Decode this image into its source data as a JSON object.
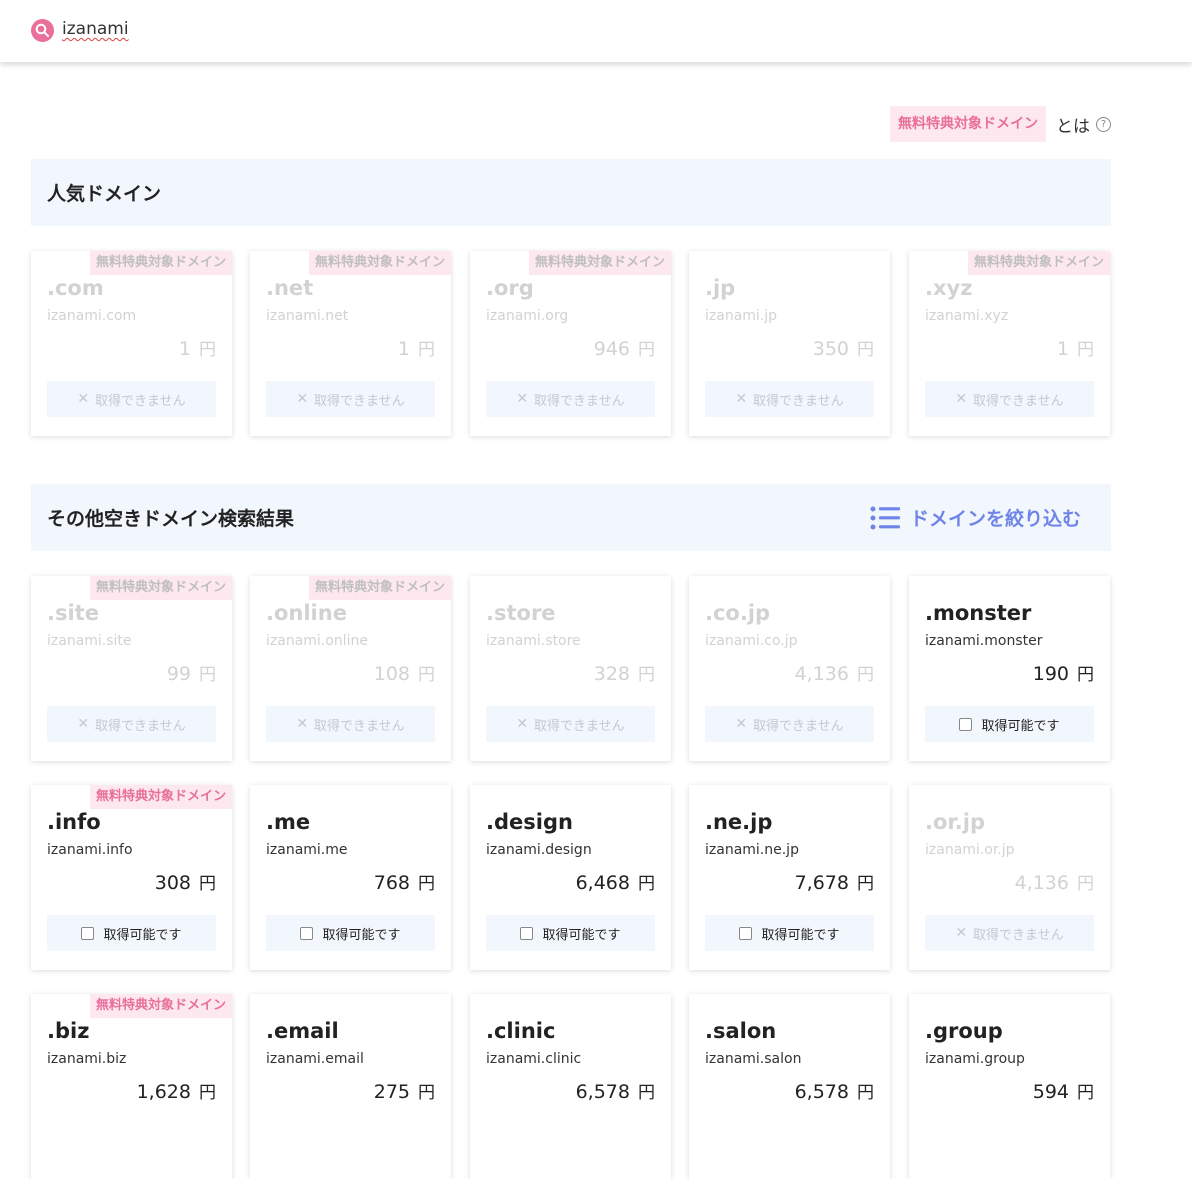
{
  "search": {
    "query": "izanami"
  },
  "info": {
    "badge": "無料特典対象ドメイン",
    "suffix": "とは",
    "help": "?"
  },
  "popular": {
    "title": "人気ドメイン",
    "cards": [
      {
        "tld": ".com",
        "fqdn": "izanami.com",
        "price": "1",
        "yen": "円",
        "free": true,
        "available": false,
        "badge": "無料特典対象ドメイン",
        "action": "取得できません"
      },
      {
        "tld": ".net",
        "fqdn": "izanami.net",
        "price": "1",
        "yen": "円",
        "free": true,
        "available": false,
        "badge": "無料特典対象ドメイン",
        "action": "取得できません"
      },
      {
        "tld": ".org",
        "fqdn": "izanami.org",
        "price": "946",
        "yen": "円",
        "free": true,
        "available": false,
        "badge": "無料特典対象ドメイン",
        "action": "取得できません"
      },
      {
        "tld": ".jp",
        "fqdn": "izanami.jp",
        "price": "350",
        "yen": "円",
        "free": false,
        "available": false,
        "badge": "",
        "action": "取得できません"
      },
      {
        "tld": ".xyz",
        "fqdn": "izanami.xyz",
        "price": "1",
        "yen": "円",
        "free": true,
        "available": false,
        "badge": "無料特典対象ドメイン",
        "action": "取得できません"
      }
    ]
  },
  "others": {
    "title": "その他空きドメイン検索結果",
    "filter_label": "ドメインを絞り込む",
    "cards": [
      {
        "tld": ".site",
        "fqdn": "izanami.site",
        "price": "99",
        "yen": "円",
        "free": true,
        "available": false,
        "badge": "無料特典対象ドメイン",
        "action": "取得できません"
      },
      {
        "tld": ".online",
        "fqdn": "izanami.online",
        "price": "108",
        "yen": "円",
        "free": true,
        "available": false,
        "badge": "無料特典対象ドメイン",
        "action": "取得できません"
      },
      {
        "tld": ".store",
        "fqdn": "izanami.store",
        "price": "328",
        "yen": "円",
        "free": false,
        "available": false,
        "badge": "",
        "action": "取得できません"
      },
      {
        "tld": ".co.jp",
        "fqdn": "izanami.co.jp",
        "price": "4,136",
        "yen": "円",
        "free": false,
        "available": false,
        "badge": "",
        "action": "取得できません"
      },
      {
        "tld": ".monster",
        "fqdn": "izanami.monster",
        "price": "190",
        "yen": "円",
        "free": false,
        "available": true,
        "badge": "",
        "action": "取得可能です"
      },
      {
        "tld": ".info",
        "fqdn": "izanami.info",
        "price": "308",
        "yen": "円",
        "free": true,
        "available": true,
        "badge": "無料特典対象ドメイン",
        "action": "取得可能です"
      },
      {
        "tld": ".me",
        "fqdn": "izanami.me",
        "price": "768",
        "yen": "円",
        "free": false,
        "available": true,
        "badge": "",
        "action": "取得可能です"
      },
      {
        "tld": ".design",
        "fqdn": "izanami.design",
        "price": "6,468",
        "yen": "円",
        "free": false,
        "available": true,
        "badge": "",
        "action": "取得可能です"
      },
      {
        "tld": ".ne.jp",
        "fqdn": "izanami.ne.jp",
        "price": "7,678",
        "yen": "円",
        "free": false,
        "available": true,
        "badge": "",
        "action": "取得可能です"
      },
      {
        "tld": ".or.jp",
        "fqdn": "izanami.or.jp",
        "price": "4,136",
        "yen": "円",
        "free": false,
        "available": false,
        "badge": "",
        "action": "取得できません"
      },
      {
        "tld": ".biz",
        "fqdn": "izanami.biz",
        "price": "1,628",
        "yen": "円",
        "free": true,
        "available": true,
        "badge": "無料特典対象ドメイン",
        "action": ""
      },
      {
        "tld": ".email",
        "fqdn": "izanami.email",
        "price": "275",
        "yen": "円",
        "free": false,
        "available": true,
        "badge": "",
        "action": ""
      },
      {
        "tld": ".clinic",
        "fqdn": "izanami.clinic",
        "price": "6,578",
        "yen": "円",
        "free": false,
        "available": true,
        "badge": "",
        "action": ""
      },
      {
        "tld": ".salon",
        "fqdn": "izanami.salon",
        "price": "6,578",
        "yen": "円",
        "free": false,
        "available": true,
        "badge": "",
        "action": ""
      },
      {
        "tld": ".group",
        "fqdn": "izanami.group",
        "price": "594",
        "yen": "円",
        "free": false,
        "available": true,
        "badge": "",
        "action": ""
      }
    ]
  }
}
